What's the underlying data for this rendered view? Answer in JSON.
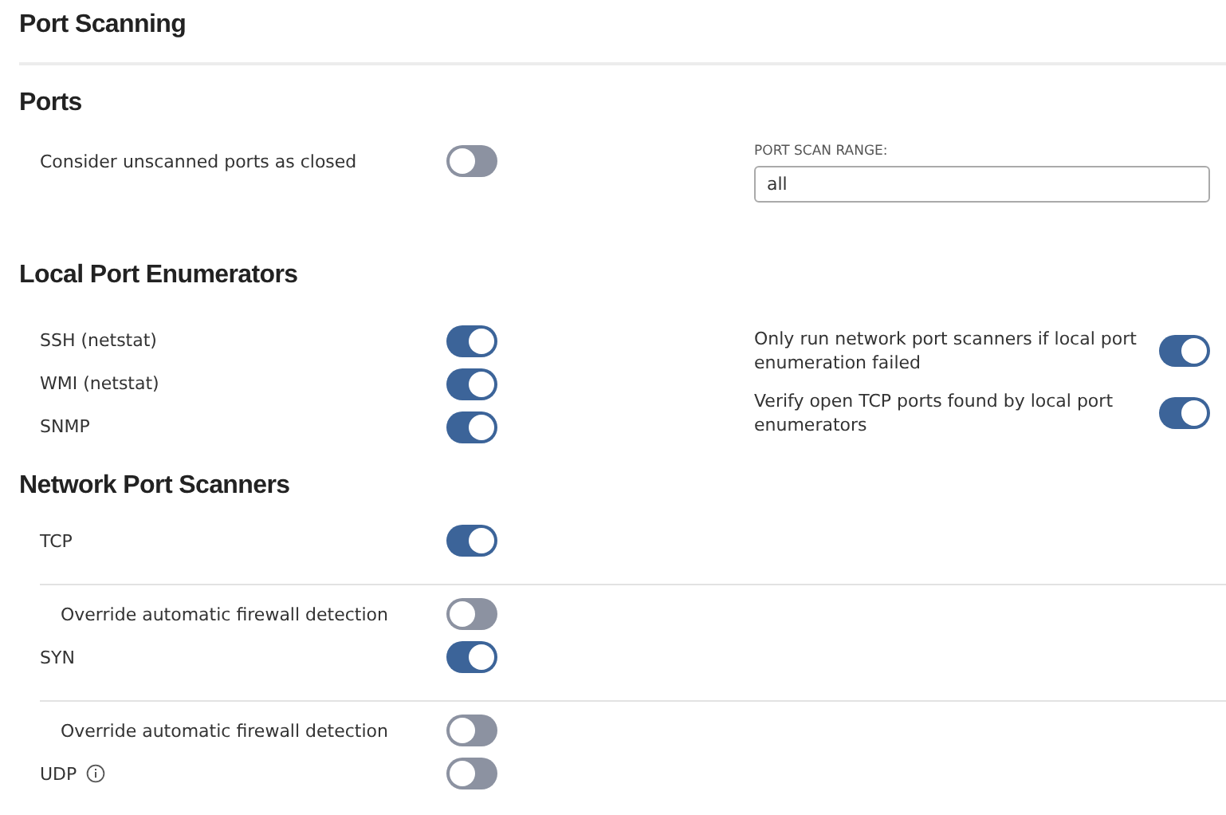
{
  "title": "Port Scanning",
  "ports": {
    "heading": "Ports",
    "options": [
      {
        "label": "Consider unscanned ports as closed",
        "on": false
      }
    ],
    "range": {
      "label": "PORT SCAN RANGE:",
      "value": "all"
    }
  },
  "enumerators": {
    "heading": "Local Port Enumerators",
    "options": [
      {
        "label": "SSH (netstat)",
        "on": true
      },
      {
        "label": "WMI (netstat)",
        "on": true
      },
      {
        "label": "SNMP",
        "on": true
      }
    ],
    "settings": [
      {
        "label": "Only run network port scanners if local port enumeration failed",
        "on": true
      },
      {
        "label": "Verify open TCP ports found by local port enumerators",
        "on": true
      }
    ]
  },
  "scanners": {
    "heading": "Network Port Scanners",
    "items": [
      {
        "label": "TCP",
        "on": true,
        "info": false,
        "override": {
          "label": "Override automatic firewall detection",
          "on": false
        }
      },
      {
        "label": "SYN",
        "on": true,
        "info": false,
        "override": {
          "label": "Override automatic firewall detection",
          "on": false
        }
      },
      {
        "label": "UDP",
        "on": false,
        "info": true
      }
    ]
  }
}
